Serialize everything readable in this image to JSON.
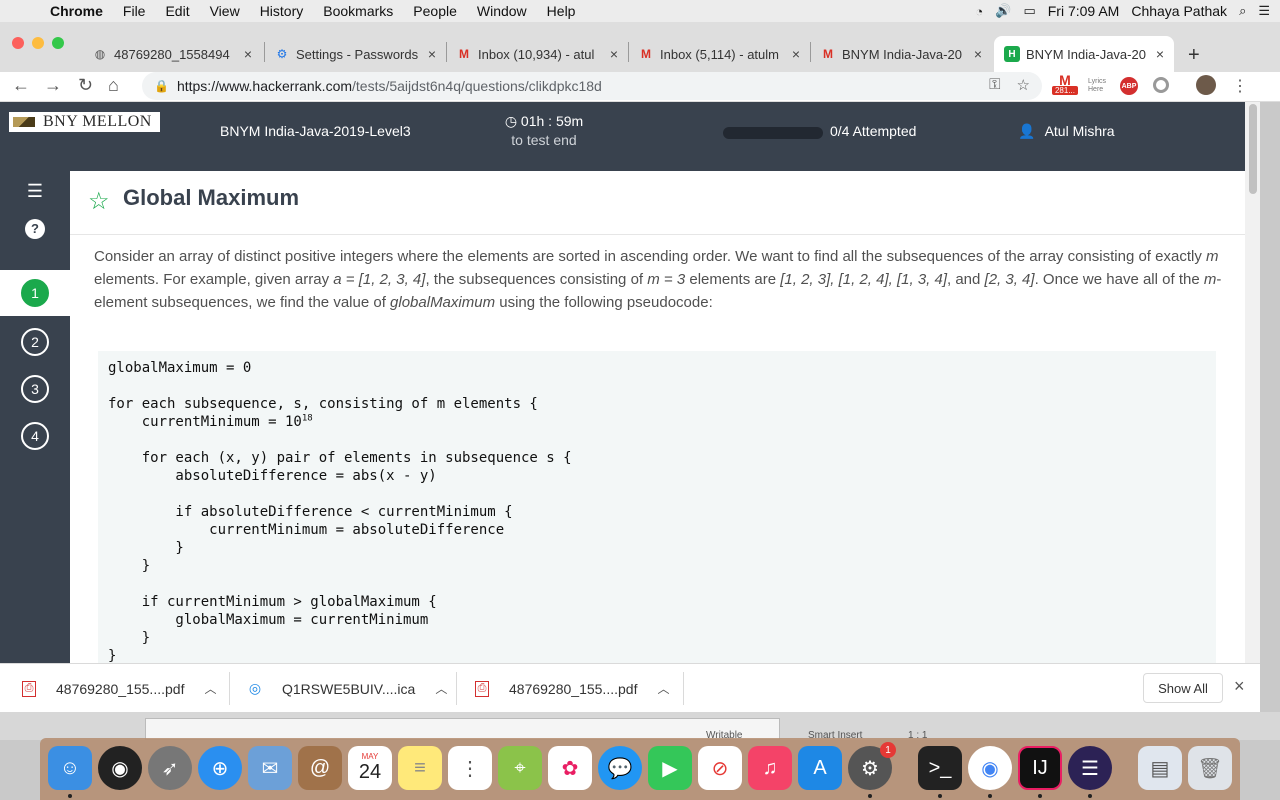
{
  "menubar": {
    "app": "Chrome",
    "items": [
      "File",
      "Edit",
      "View",
      "History",
      "Bookmarks",
      "People",
      "Window",
      "Help"
    ],
    "clock": "Fri 7:09 AM",
    "user": "Chhaya Pathak"
  },
  "tabs": [
    {
      "title": "48769280_1558494",
      "icon": "globe-icon"
    },
    {
      "title": "Settings - Passwords",
      "icon": "gear-icon"
    },
    {
      "title": "Inbox (10,934) - atul",
      "icon": "gmail-icon"
    },
    {
      "title": "Inbox (5,114) - atulm",
      "icon": "gmail-icon"
    },
    {
      "title": "BNYM India-Java-20",
      "icon": "gmail-icon"
    },
    {
      "title": "BNYM India-Java-20",
      "icon": "hackerrank-icon"
    }
  ],
  "address": {
    "host": "https://www.hackerrank.com",
    "path": "/tests/5aijdst6n4q/questions/clikdpkc18d"
  },
  "extensions": {
    "gmail_badge": "281...",
    "lyrics": "Lyrics Here",
    "abp": "ABP"
  },
  "header": {
    "logo_text": "BNY MELLON",
    "test_name": "BNYM India-Java-2019-Level3",
    "timer": "01h : 59m",
    "timer_sub": "to test end",
    "progress": 0,
    "attempted": "0/4 Attempted",
    "user": "Atul Mishra"
  },
  "sidebar": {
    "questions": [
      "1",
      "2",
      "3",
      "4"
    ],
    "selected": "1"
  },
  "question": {
    "title": "Global Maximum",
    "desc_part1": "Consider an array of distinct positive integers where the elements are sorted in ascending order. We want to find all the subsequences of the array consisting of exactly ",
    "m": "m",
    "desc_part2": " elements. For example, given array ",
    "array_eq": "a = [1, 2, 3, 4]",
    "desc_part3": ", the subsequences consisting of ",
    "m_eq": "m = 3",
    "desc_part4": " elements are ",
    "subseqs": "[1, 2, 3], [1, 2, 4], [1, 3, 4]",
    "desc_part5": ", and ",
    "last_subseq": "[2, 3, 4]",
    "desc_part6": ". Once we have all of the ",
    "desc_part7": "-element subsequences, we find the value of ",
    "gm": "globalMaximum",
    "desc_part8": " using the following pseudocode:",
    "code_lines": [
      "globalMaximum = 0",
      "",
      "for each subsequence, s, consisting of m elements {",
      "    currentMinimum = 10",
      "",
      "    for each (x, y) pair of elements in subsequence s {",
      "        absoluteDifference = abs(x - y)",
      "",
      "        if absoluteDifference < currentMinimum {",
      "            currentMinimum = absoluteDifference",
      "        }",
      "    }",
      "",
      "    if currentMinimum > globalMaximum {",
      "        globalMaximum = currentMinimum",
      "    }",
      "}"
    ],
    "exponent": "18"
  },
  "downloads": {
    "items": [
      {
        "name": "48769280_155....pdf",
        "icon": "pdf-icon"
      },
      {
        "name": "Q1RSWE5BUIV....ica",
        "icon": "citrix-icon"
      },
      {
        "name": "48769280_155....pdf",
        "icon": "pdf-icon"
      }
    ],
    "show_all": "Show All"
  },
  "behind_window": {
    "writable": "Writable",
    "smart_insert": "Smart Insert",
    "position": "1 : 1"
  },
  "dock": {
    "calendar_month": "MAY",
    "calendar_day": "24",
    "prefs_badge": "1"
  }
}
